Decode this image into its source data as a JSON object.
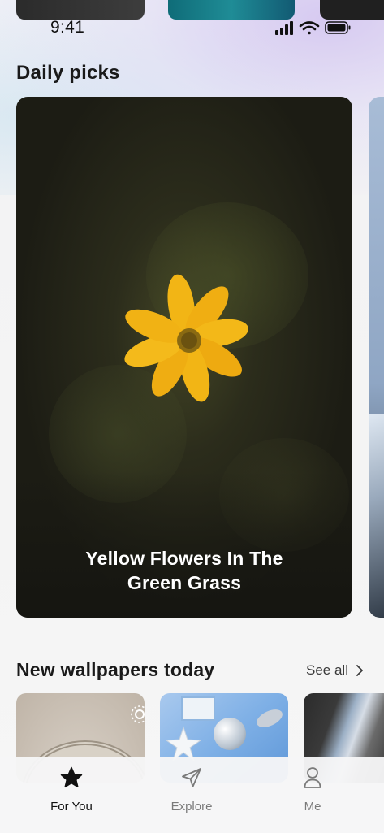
{
  "status_bar": {
    "time": "9:41"
  },
  "daily_picks": {
    "title": "Daily picks",
    "featured": {
      "caption_line1": "Yellow Flowers In The",
      "caption_line2": "Green Grass"
    }
  },
  "new_wallpapers": {
    "title": "New wallpapers today",
    "see_all_label": "See all"
  },
  "tabbar": {
    "items": [
      {
        "label": "For You",
        "icon": "star-icon",
        "active": true
      },
      {
        "label": "Explore",
        "icon": "navigation-arrow-icon",
        "active": false
      },
      {
        "label": "Me",
        "icon": "person-icon",
        "active": false
      }
    ]
  },
  "colors": {
    "accent_active": "#111111",
    "tab_inactive": "#7a7a7a",
    "flower_yellow": "#f2b515"
  }
}
